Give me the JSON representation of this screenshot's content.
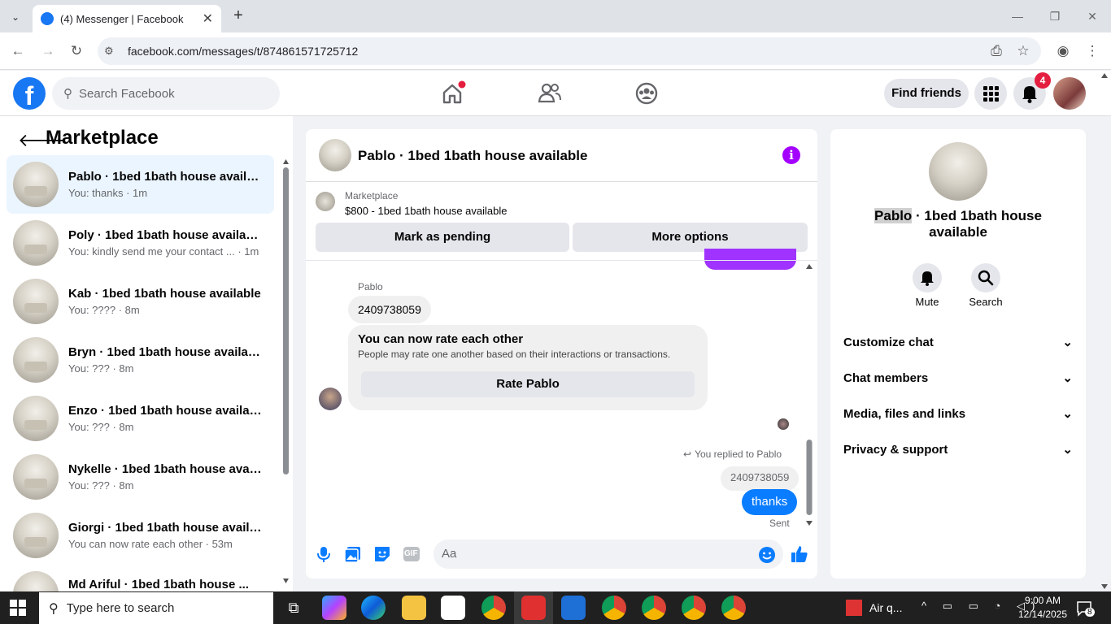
{
  "browser": {
    "tab_title": "(4) Messenger | Facebook",
    "url": "facebook.com/messages/t/874861571725712"
  },
  "fb_header": {
    "logo": "f",
    "search_placeholder": "Search Facebook",
    "find_friends": "Find friends",
    "notification_count": "4"
  },
  "marketplace": {
    "title": "Marketplace",
    "conversations": [
      {
        "name": "Pablo · 1bed 1bath house available",
        "preview": "You: thanks · 1m",
        "active": true
      },
      {
        "name": "Poly · 1bed 1bath house available",
        "preview": "You: kindly send me your contact ...  · 1m"
      },
      {
        "name": "Kab · 1bed 1bath house available",
        "preview": "You: ???? · 8m"
      },
      {
        "name": "Bryn · 1bed 1bath house available",
        "preview": "You: ??? · 8m"
      },
      {
        "name": "Enzo · 1bed 1bath house available",
        "preview": "You: ??? · 8m"
      },
      {
        "name": "Nykelle · 1bed 1bath house avail...",
        "preview": "You: ??? · 8m"
      },
      {
        "name": "Giorgi · 1bed 1bath house availa...",
        "preview": "You can now rate each other · 53m"
      },
      {
        "name": "Md Ariful · 1bed 1bath house ...",
        "preview": ""
      }
    ]
  },
  "chat": {
    "title": "Pablo · 1bed 1bath house available",
    "info_icon": "i",
    "listing_label": "Marketplace",
    "listing": "$800 - 1bed 1bath house available",
    "mark_pending": "Mark as pending",
    "more_options": "More options",
    "sender_name": "Pablo",
    "received_message": "2409738059",
    "rate_title": "You can now rate each other",
    "rate_subtitle": "People may rate one another based on their interactions or transactions.",
    "rate_button": "Rate Pablo",
    "replied_label": "You replied to Pablo",
    "quoted_message": "2409738059",
    "sent_message": "thanks",
    "status": "Sent",
    "input_placeholder": "Aa",
    "gif_label": "GIF"
  },
  "details": {
    "name_highlight": "Pablo",
    "name_rest": " · 1bed 1bath house available",
    "mute": "Mute",
    "search": "Search",
    "sections": [
      "Customize chat",
      "Chat members",
      "Media, files and links",
      "Privacy & support"
    ]
  },
  "taskbar": {
    "search_placeholder": "Type here to search",
    "weather": "Air q...",
    "time": "9:00 AM",
    "date": "12/14/2025",
    "notif_count": "8"
  },
  "colors": {
    "fb_blue": "#1877f2",
    "messenger_purple": "#a033ff",
    "bubble_blue": "#0a7cff",
    "badge_red": "#e41e3f"
  }
}
